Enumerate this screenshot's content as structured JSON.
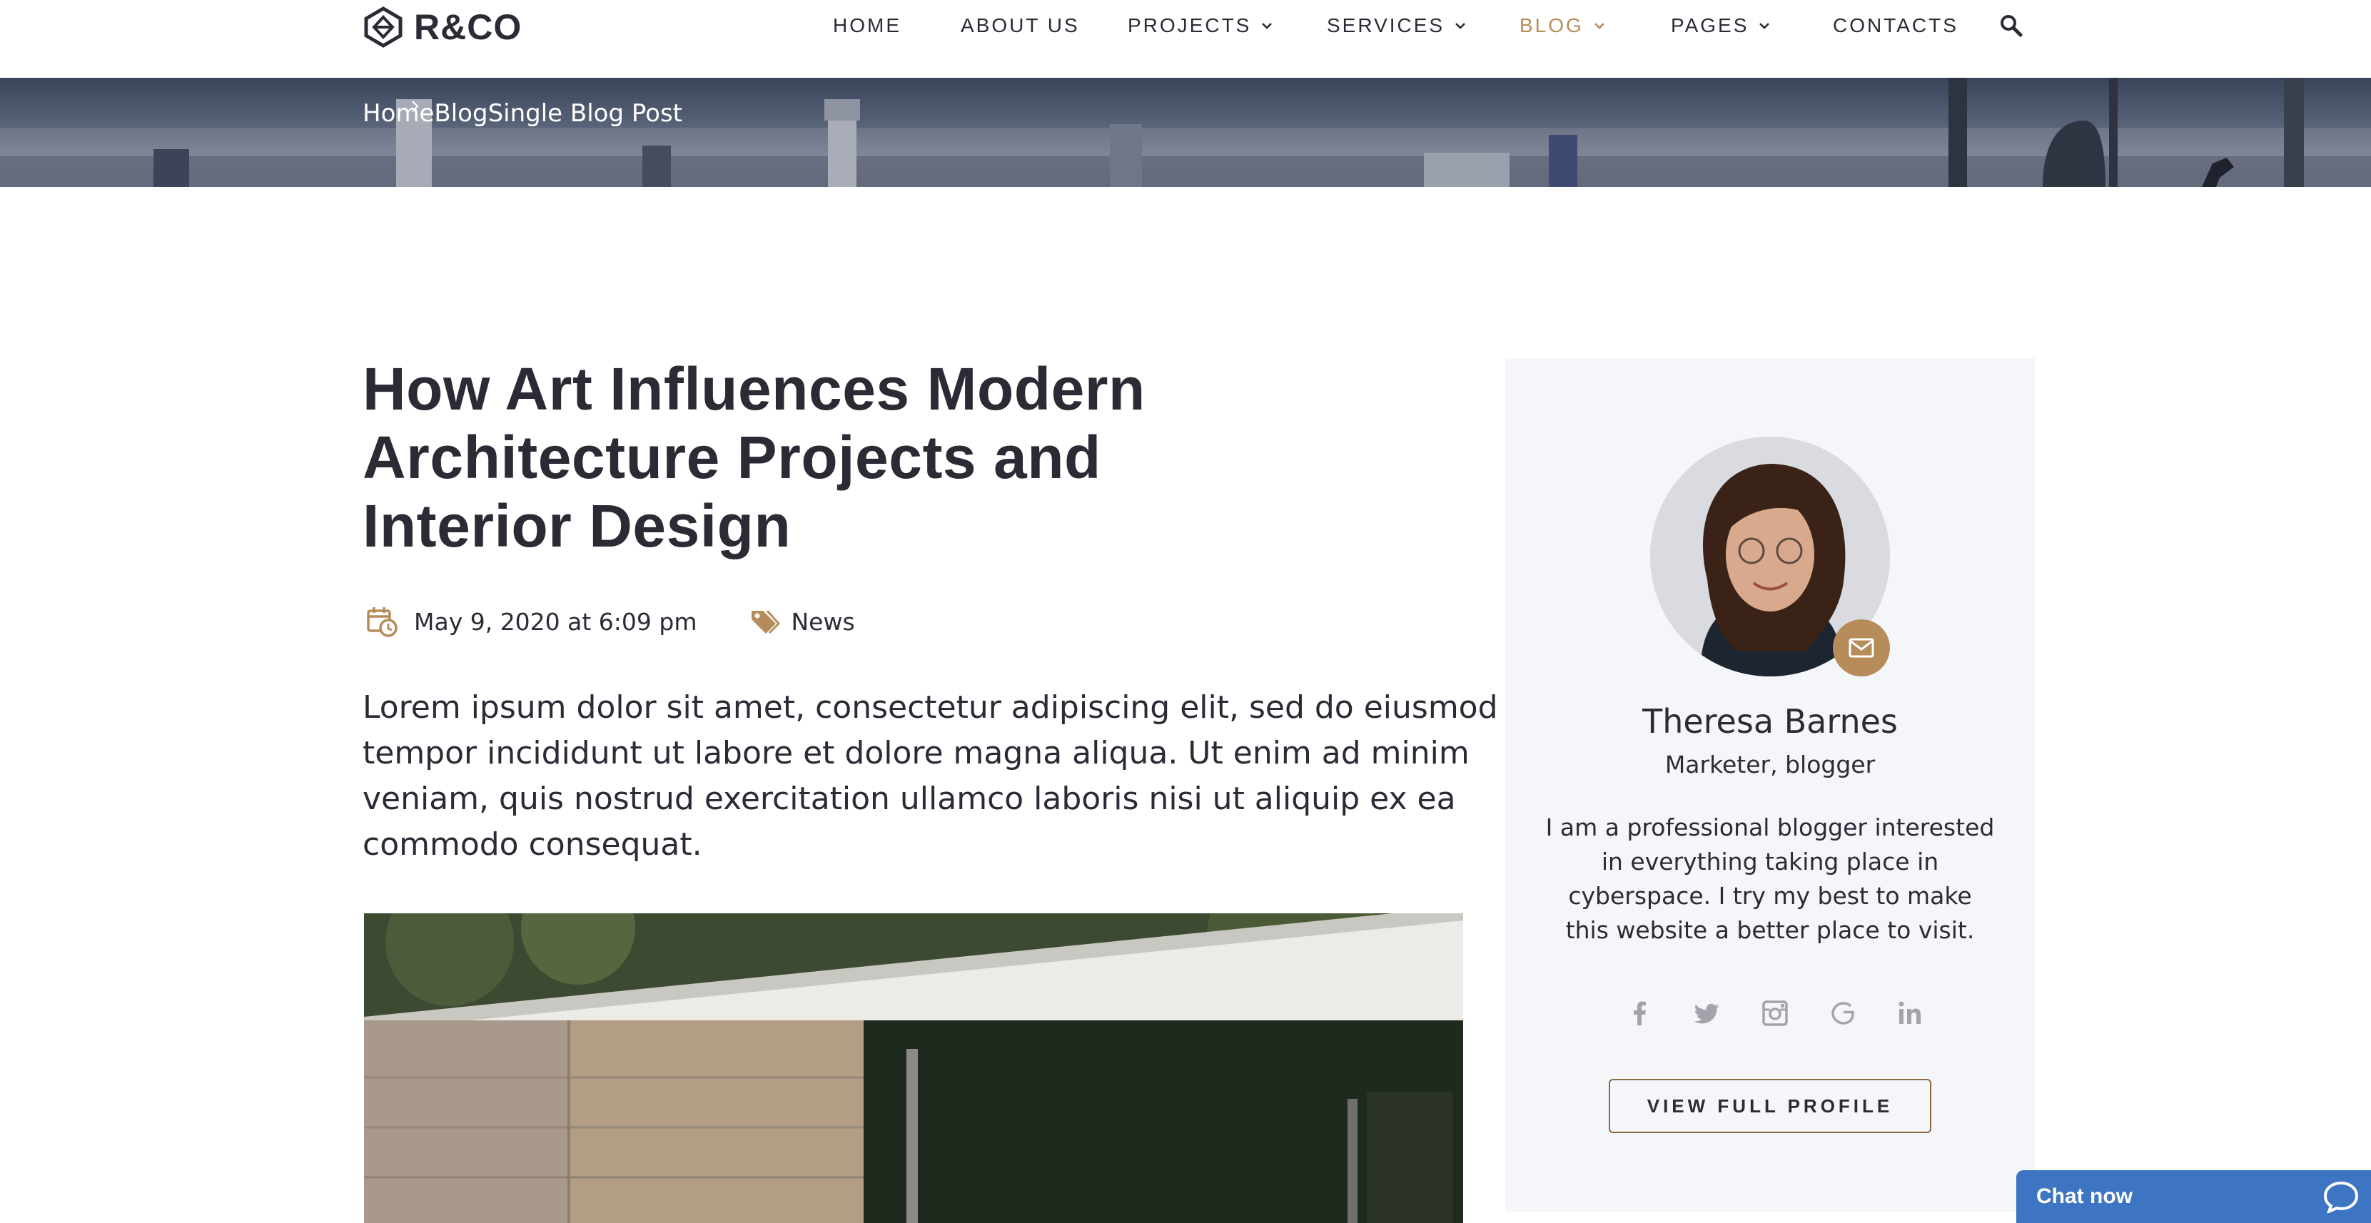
{
  "header": {
    "logo_text": "R&CO",
    "nav": [
      {
        "label": "HOME",
        "has_dropdown": false,
        "active": false
      },
      {
        "label": "ABOUT US",
        "has_dropdown": false,
        "active": false
      },
      {
        "label": "PROJECTS",
        "has_dropdown": true,
        "active": false
      },
      {
        "label": "SERVICES",
        "has_dropdown": true,
        "active": false
      },
      {
        "label": "BLOG",
        "has_dropdown": true,
        "active": true
      },
      {
        "label": "PAGES",
        "has_dropdown": true,
        "active": false
      },
      {
        "label": "CONTACTS",
        "has_dropdown": false,
        "active": false
      }
    ],
    "search_icon": "search-icon"
  },
  "breadcrumb": {
    "items": [
      "Home",
      "Blog",
      "Single Blog Post"
    ],
    "separator_icon": "chevron-right-icon"
  },
  "article": {
    "title_lines": [
      "How Art Influences Modern",
      "Architecture Projects and",
      "Interior Design"
    ],
    "date": "May 9, 2020 at 6:09 pm",
    "date_icon": "calendar-clock-icon",
    "category": "News",
    "category_icon": "tags-icon",
    "lead_lines": [
      "Lorem ipsum dolor sit amet, consectetur adipiscing elit, sed do eiusmod",
      "tempor incididunt ut labore et dolore magna aliqua. Ut enim ad minim",
      "veniam, quis nostrud exercitation ullamco laboris nisi ut aliquip ex ea",
      "commodo consequat."
    ]
  },
  "author": {
    "name": "Theresa Barnes",
    "role": "Marketer, blogger",
    "bio_lines": [
      "I am a professional blogger interested",
      "in everything taking place in",
      "cyberspace. I try my best to make",
      "this website a better place to visit."
    ],
    "mail_icon": "mail-icon",
    "socials": [
      "facebook-icon",
      "twitter-icon",
      "instagram-icon",
      "google-icon",
      "linkedin-icon"
    ],
    "button_label": "VIEW FULL PROFILE"
  },
  "chat": {
    "label": "Chat now",
    "icon": "chat-bubble-icon"
  },
  "colors": {
    "accent": "#b68c5a",
    "text": "#2a2b35",
    "card_bg": "#f5f6fa",
    "chat_bg": "#3e75c3"
  }
}
